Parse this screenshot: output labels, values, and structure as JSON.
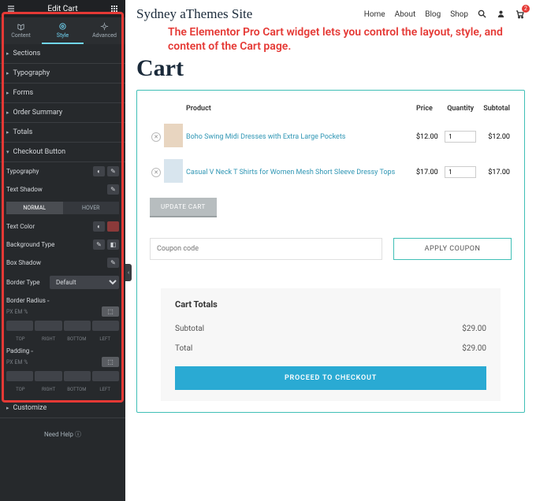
{
  "sidebar": {
    "title": "Edit Cart",
    "tabs": [
      {
        "label": "Content"
      },
      {
        "label": "Style"
      },
      {
        "label": "Advanced"
      }
    ],
    "sections": {
      "sections": "Sections",
      "typography": "Typography",
      "forms": "Forms",
      "order_summary": "Order Summary",
      "totals": "Totals",
      "checkout_button": "Checkout Button",
      "customize": "Customize"
    },
    "controls": {
      "typography": "Typography",
      "text_shadow": "Text Shadow",
      "normal": "NORMAL",
      "hover": "HOVER",
      "text_color": "Text Color",
      "background_type": "Background Type",
      "box_shadow": "Box Shadow",
      "border_type": "Border Type",
      "border_type_value": "Default",
      "border_radius": "Border Radius",
      "padding": "Padding",
      "dims": [
        "TOP",
        "RIGHT",
        "BOTTOM",
        "LEFT"
      ],
      "units": "PX EM %"
    },
    "help": "Need Help"
  },
  "site": {
    "brand": "Sydney aThemes Site",
    "nav": [
      "Home",
      "About",
      "Blog",
      "Shop"
    ],
    "cart_count": "2"
  },
  "callout": "The Elementor Pro Cart widget lets you control the layout, style, and content of the Cart page.",
  "page_title": "Cart",
  "cart": {
    "headers": {
      "product": "Product",
      "price": "Price",
      "quantity": "Quantity",
      "subtotal": "Subtotal"
    },
    "items": [
      {
        "name": "Boho Swing Midi Dresses with Extra Large Pockets",
        "price": "$12.00",
        "qty": "1",
        "subtotal": "$12.00"
      },
      {
        "name": "Casual V Neck T Shirts for Women Mesh Short Sleeve Dressy Tops",
        "price": "$17.00",
        "qty": "1",
        "subtotal": "$17.00"
      }
    ],
    "update": "UPDATE CART",
    "coupon_placeholder": "Coupon code",
    "apply": "APPLY COUPON"
  },
  "totals": {
    "title": "Cart Totals",
    "subtotal_label": "Subtotal",
    "subtotal": "$29.00",
    "total_label": "Total",
    "total": "$29.00",
    "checkout": "PROCEED TO CHECKOUT"
  }
}
